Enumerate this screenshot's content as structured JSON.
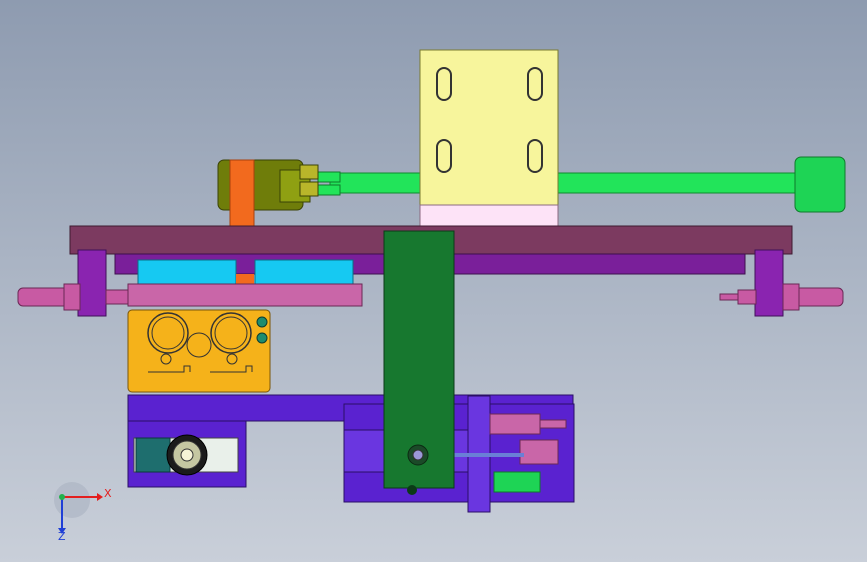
{
  "viewport": {
    "background_top": "#8e9bb0",
    "background_bottom": "#c9cfd9"
  },
  "triad": {
    "x_label": "X",
    "z_label": "Z",
    "x_color": "#e31e1e",
    "y_color": "#22b14c",
    "z_color": "#1f3fd6"
  },
  "model_colors": {
    "yellow_plate": "#f7f59a",
    "pink_pad": "#fde6f7",
    "green_rod": "#1ee65a",
    "olive_cylinder": "#7a8a0a",
    "orange_block": "#f06a22",
    "maroon_bar": "#7d3d63",
    "purple_bar": "#8a20a8",
    "cyan_block": "#18c9f0",
    "pink_bar": "#c965a6",
    "gold_block": "#f5b21a",
    "indigo_base": "#5a1fd6",
    "dark_green_arm": "#177a32",
    "teal_block": "#1e6e6e",
    "magenta_fitting": "#c85aa3"
  }
}
